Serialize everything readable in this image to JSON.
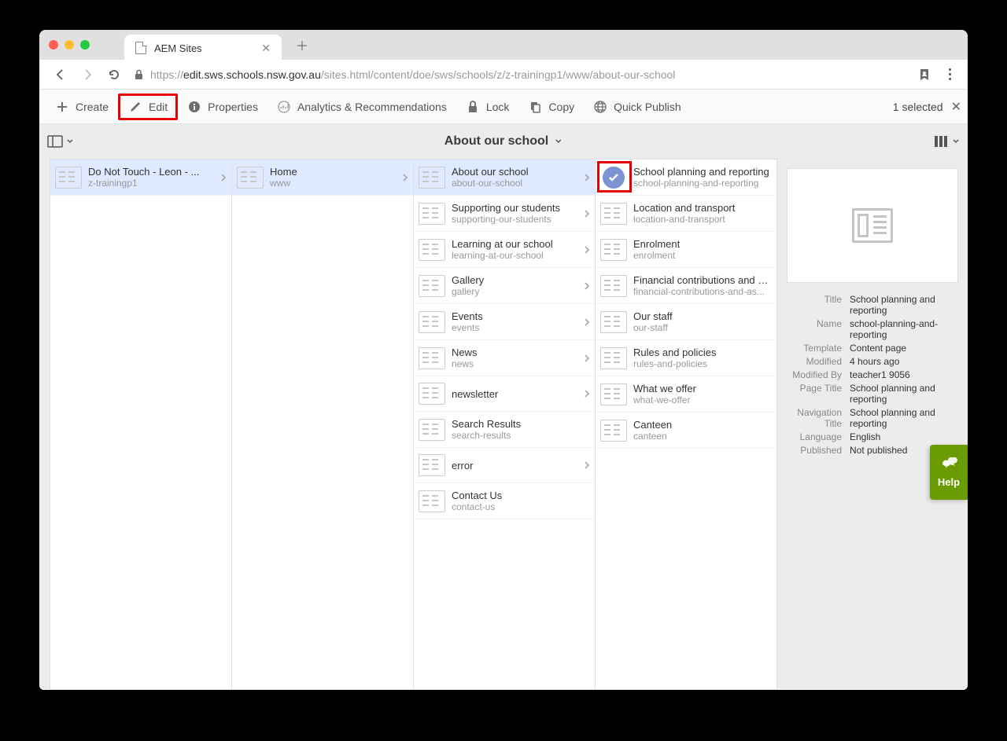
{
  "browser": {
    "tab_title": "AEM Sites",
    "url_prefix": "https://",
    "url_host": "edit.sws.schools.nsw.gov.au",
    "url_path": "/sites.html/content/doe/sws/schools/z/z-trainingp1/www/about-our-school"
  },
  "actionbar": {
    "create": "Create",
    "edit": "Edit",
    "properties": "Properties",
    "analytics": "Analytics & Recommendations",
    "lock": "Lock",
    "copy": "Copy",
    "quick_publish": "Quick Publish",
    "selected": "1 selected"
  },
  "subbar": {
    "title": "About our school"
  },
  "columns": [
    {
      "items": [
        {
          "title": "Do Not Touch - Leon - ...",
          "name": "z-trainingp1",
          "chev": true,
          "selected": true
        }
      ]
    },
    {
      "items": [
        {
          "title": "Home",
          "name": "www",
          "chev": true,
          "selected": true
        }
      ]
    },
    {
      "items": [
        {
          "title": "About our school",
          "name": "about-our-school",
          "chev": true,
          "selected": true
        },
        {
          "title": "Supporting our students",
          "name": "supporting-our-students",
          "chev": true
        },
        {
          "title": "Learning at our school",
          "name": "learning-at-our-school",
          "chev": true
        },
        {
          "title": "Gallery",
          "name": "gallery",
          "chev": true
        },
        {
          "title": "Events",
          "name": "events",
          "chev": true
        },
        {
          "title": "News",
          "name": "news",
          "chev": true
        },
        {
          "title": "newsletter",
          "name": "",
          "chev": true
        },
        {
          "title": "Search Results",
          "name": "search-results"
        },
        {
          "title": "error",
          "name": "",
          "chev": true
        },
        {
          "title": "Contact Us",
          "name": "contact-us"
        }
      ]
    },
    {
      "items": [
        {
          "title": "School planning and reporting",
          "name": "school-planning-and-reporting",
          "checked": true,
          "highlighted": true
        },
        {
          "title": "Location and transport",
          "name": "location-and-transport"
        },
        {
          "title": "Enrolment",
          "name": "enrolment"
        },
        {
          "title": "Financial contributions and as...",
          "name": "financial-contributions-and-as..."
        },
        {
          "title": "Our staff",
          "name": "our-staff"
        },
        {
          "title": "Rules and policies",
          "name": "rules-and-policies"
        },
        {
          "title": "What we offer",
          "name": "what-we-offer"
        },
        {
          "title": "Canteen",
          "name": "canteen"
        }
      ]
    }
  ],
  "properties": {
    "Title": "School planning and reporting",
    "Name": "school-planning-and-reporting",
    "Template": "Content page",
    "Modified": "4 hours ago",
    "Modified By": "teacher1 9056",
    "Page Title": "School planning and reporting",
    "Navigation Title": "School planning and reporting",
    "Language": "English",
    "Published": "Not published"
  },
  "help_label": "Help"
}
